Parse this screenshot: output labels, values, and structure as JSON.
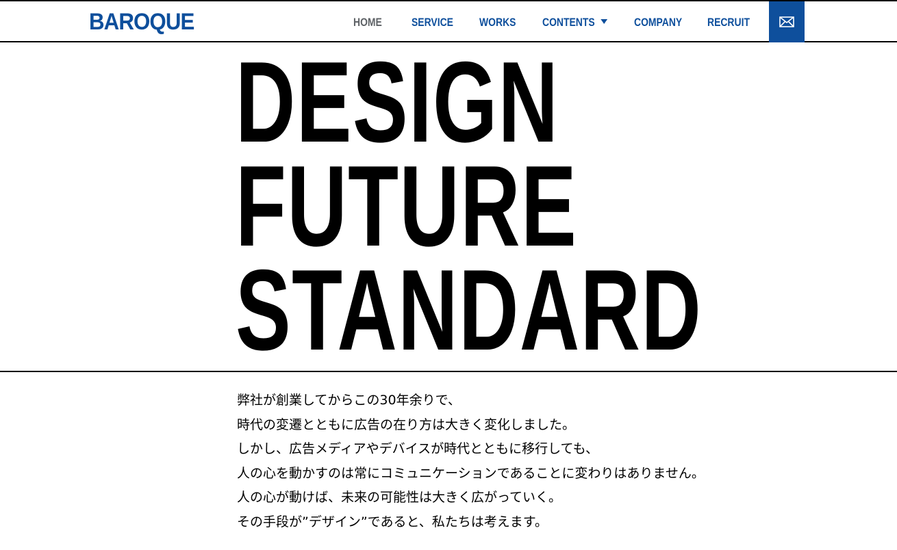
{
  "header": {
    "logo": "BAROQUE",
    "nav": [
      {
        "label": "HOME",
        "active": true
      },
      {
        "label": "SERVICE"
      },
      {
        "label": "WORKS"
      },
      {
        "label": "CONTENTS",
        "has_dropdown": true
      },
      {
        "label": "COMPANY"
      },
      {
        "label": "RECRUIT"
      }
    ],
    "mail_icon": "mail-icon"
  },
  "hero": {
    "lines": [
      "DESIGN",
      "FUTURE",
      "STANDARD"
    ]
  },
  "intro": {
    "lines": [
      "弊社が創業してからこの30年余りで、",
      "時代の変遷とともに広告の在り方は大きく変化しました。",
      "しかし、広告メディアやデバイスが時代とともに移行しても、",
      "人の心を動かすのは常にコミュニケーションであることに変わりはありません。",
      "人の心が動けば、未来の可能性は大きく広がっていく。",
      "その手段が”デザイン”であると、私たちは考えます。"
    ]
  },
  "colors": {
    "brand": "#0e4f9c",
    "nav_active": "#5e6266",
    "text": "#000000",
    "background": "#ffffff"
  }
}
